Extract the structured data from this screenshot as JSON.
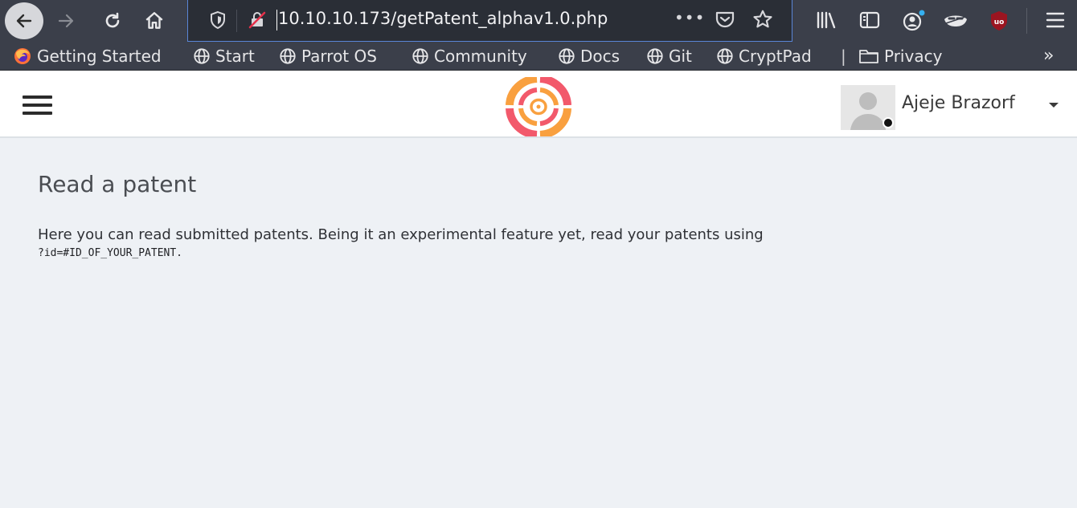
{
  "browser": {
    "url": "10.10.10.173/getPatent_alphav1.0.php",
    "more_label": "•••",
    "bookmarks": [
      {
        "label": "Getting Started"
      },
      {
        "label": "Start"
      },
      {
        "label": "Parrot OS"
      },
      {
        "label": "Community"
      },
      {
        "label": "Docs"
      },
      {
        "label": "Git"
      },
      {
        "label": "CryptPad"
      },
      {
        "label": "Privacy"
      }
    ],
    "bookmark_divider": "|",
    "overflow": "»"
  },
  "header": {
    "user_name": "Ajeje Brazorf"
  },
  "main": {
    "title": "Read a patent",
    "description": "Here you can read submitted patents. Being it an experimental feature yet, read your patents using",
    "code": "?id=#ID_OF_YOUR_PATENT."
  },
  "colors": {
    "chrome": "#3b3f4a",
    "urlbar": "#2a2e36",
    "page_bg": "#eef1f5",
    "logo_orange": "#f9a03f",
    "logo_pink": "#f2596b"
  }
}
